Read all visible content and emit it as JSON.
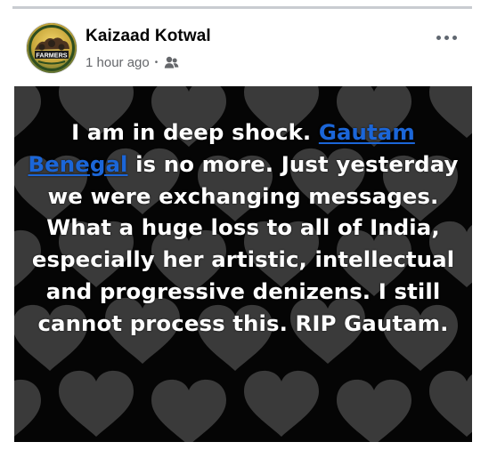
{
  "post": {
    "author": "Kaizaad Kotwal",
    "timestamp": "1 hour ago",
    "separator": "•",
    "audience_icon": "friends-icon",
    "more_icon": "more-options-icon",
    "avatar_logo_text": "FARMERS",
    "quote": {
      "before": "I am in deep shock. ",
      "mention": "Gautam Benegal",
      "after": " is no more. Just yesterday we were exchanging messages. What a huge loss to all of India, especially her artistic,  intellectual and progressive denizens. I still cannot process this. RIP Gautam."
    },
    "colors": {
      "mention": "#1b66d8",
      "background": "#050505",
      "hearts": "#3a3a3a"
    }
  }
}
